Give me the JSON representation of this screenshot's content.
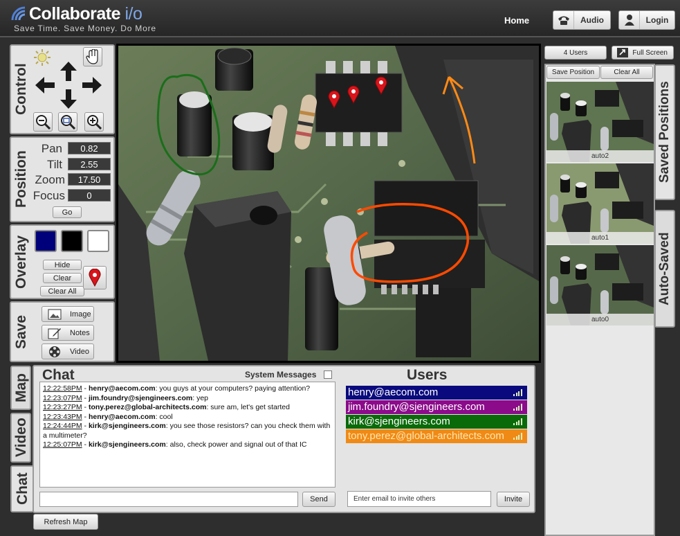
{
  "header": {
    "logo_main": "Collaborate ",
    "logo_accent": "i/o",
    "tagline": "Save Time. Save Money. Do More",
    "home_label": "Home",
    "audio_label": "Audio",
    "login_label": "Login"
  },
  "control": {
    "title": "Control"
  },
  "position": {
    "title": "Position",
    "pan_label": "Pan",
    "pan_value": "0.82",
    "tilt_label": "Tilt",
    "tilt_value": "2.55",
    "zoom_label": "Zoom",
    "zoom_value": "17.50",
    "focus_label": "Focus",
    "focus_value": "0",
    "go_label": "Go"
  },
  "overlay": {
    "title": "Overlay",
    "colors": [
      "#00007a",
      "#000000",
      "#ffffff"
    ],
    "hide_label": "Hide",
    "clear_label": "Clear",
    "clear_all_label": "Clear All",
    "marker_color": "#d9141b"
  },
  "save": {
    "title": "Save",
    "image_label": "Image",
    "notes_label": "Notes",
    "video_label": "Video"
  },
  "left_tabs": {
    "map": "Map",
    "video": "Video",
    "chat": "Chat",
    "refresh_map": "Refresh Map"
  },
  "chat": {
    "title": "Chat",
    "system_messages_label": "System Messages",
    "send_label": "Send",
    "messages": [
      {
        "time": "12:22:58PM",
        "user": "henry@aecom.com",
        "text": ": you guys at your computers?  paying attention?"
      },
      {
        "time": "12:23:07PM",
        "user": "jim.foundry@sjengineers.com",
        "text": ": yep"
      },
      {
        "time": "12:23:27PM",
        "user": "tony.perez@global-architects.com",
        "text": ": sure am, let's get started"
      },
      {
        "time": "12:23:43PM",
        "user": "henry@aecom.com",
        "text": ": cool"
      },
      {
        "time": "12:24:44PM",
        "user": "kirk@sjengineers.com",
        "text": ": you see those resistors?  can you check them with a multimeter?"
      },
      {
        "time": "12:25:07PM",
        "user": "kirk@sjengineers.com",
        "text": ": also, check power and signal out of that IC"
      }
    ]
  },
  "users": {
    "title": "Users",
    "list": [
      {
        "email": "henry@aecom.com",
        "color": "#0a0a7e",
        "text_color": "#ffffff"
      },
      {
        "email": "jim.foundry@sjengineers.com",
        "color": "#8b0b8b",
        "text_color": "#ffffff"
      },
      {
        "email": "kirk@sjengineers.com",
        "color": "#0a6a0a",
        "text_color": "#ffffff"
      },
      {
        "email": "tony.perez@global-architects.com",
        "color": "#f08a16",
        "text_color": "#ffe6b0"
      }
    ],
    "invite_value": "Enter email to invite others",
    "invite_label": "Invite"
  },
  "right": {
    "users_count_label": "4 Users",
    "fullscreen_label": "Full Screen",
    "save_position_label": "Save Position",
    "clear_all_label": "Clear All",
    "saved_positions_tab": "Saved Positions",
    "auto_saved_tab": "Auto-Saved",
    "thumbs": [
      {
        "caption": "auto2"
      },
      {
        "caption": "auto1"
      },
      {
        "caption": "auto0"
      }
    ]
  },
  "markers": {
    "color": "#d9141b"
  },
  "annotations": {
    "green": "#1a6e1a",
    "orange": "#ff8a14",
    "red_orange": "#ff4a00"
  }
}
